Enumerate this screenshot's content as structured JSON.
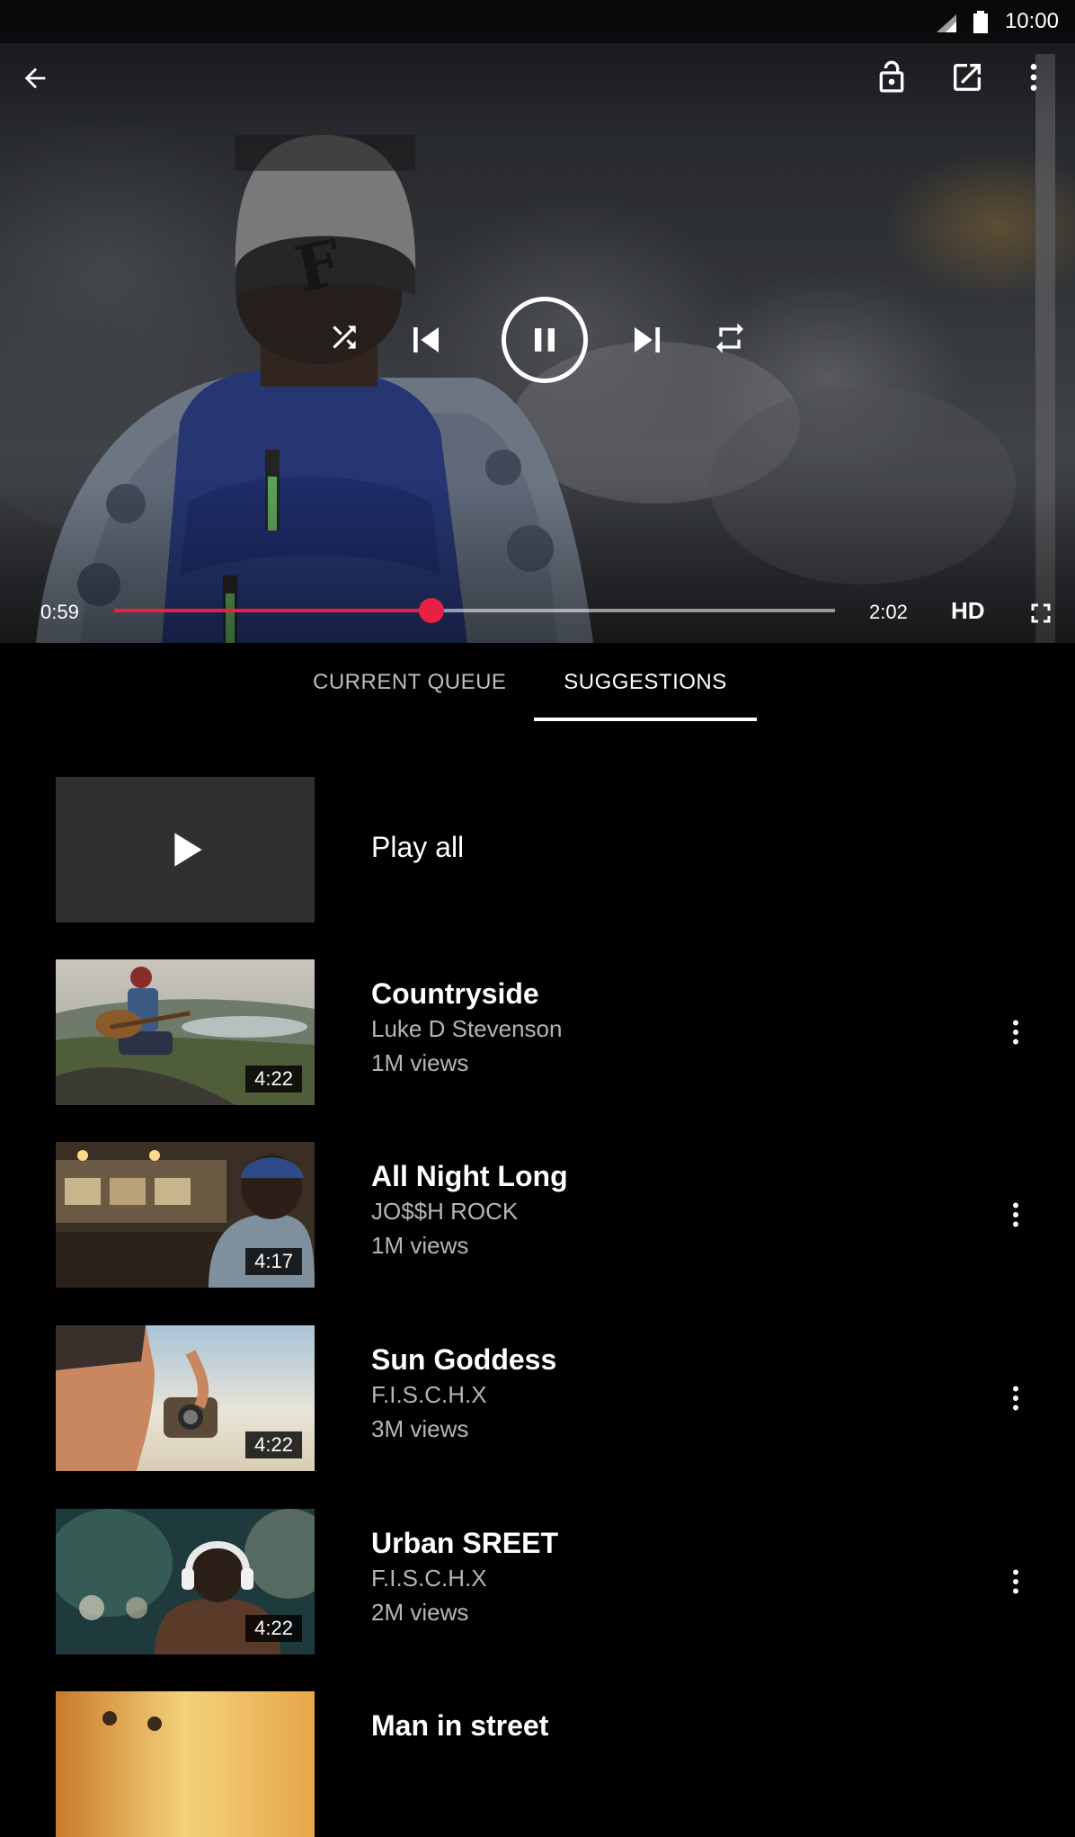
{
  "status_bar": {
    "time": "10:00",
    "icons": [
      "signal-icon",
      "battery-icon"
    ]
  },
  "player": {
    "top_icons": [
      "back-arrow-icon",
      "lock-icon",
      "popout-icon",
      "more-vert-icon"
    ],
    "center_icons": [
      "shuffle-icon",
      "skip-previous-icon",
      "pause-icon",
      "skip-next-icon",
      "repeat-icon"
    ],
    "current_time": "0:59",
    "total_time": "2:02",
    "progress_fraction": 0.44,
    "quality_label": "HD",
    "accent_color": "#e62143"
  },
  "tabs": [
    {
      "label": "CURRENT QUEUE",
      "selected": false
    },
    {
      "label": "SUGGESTIONS",
      "selected": true
    }
  ],
  "play_all": {
    "label": "Play all",
    "icon": "play-icon"
  },
  "suggestions": [
    {
      "title": "Countryside",
      "channel": "Luke D Stevenson",
      "views": "1M views",
      "duration": "4:22"
    },
    {
      "title": "All Night Long",
      "channel": "JO$$H ROCK",
      "views": "1M views",
      "duration": "4:17"
    },
    {
      "title": "Sun Goddess",
      "channel": "F.I.S.C.H.X",
      "views": "3M views",
      "duration": "4:22"
    },
    {
      "title": "Urban SREET",
      "channel": "F.I.S.C.H.X",
      "views": "2M views",
      "duration": "4:22"
    },
    {
      "title": "Man in street",
      "channel": "",
      "views": "",
      "duration": ""
    }
  ]
}
